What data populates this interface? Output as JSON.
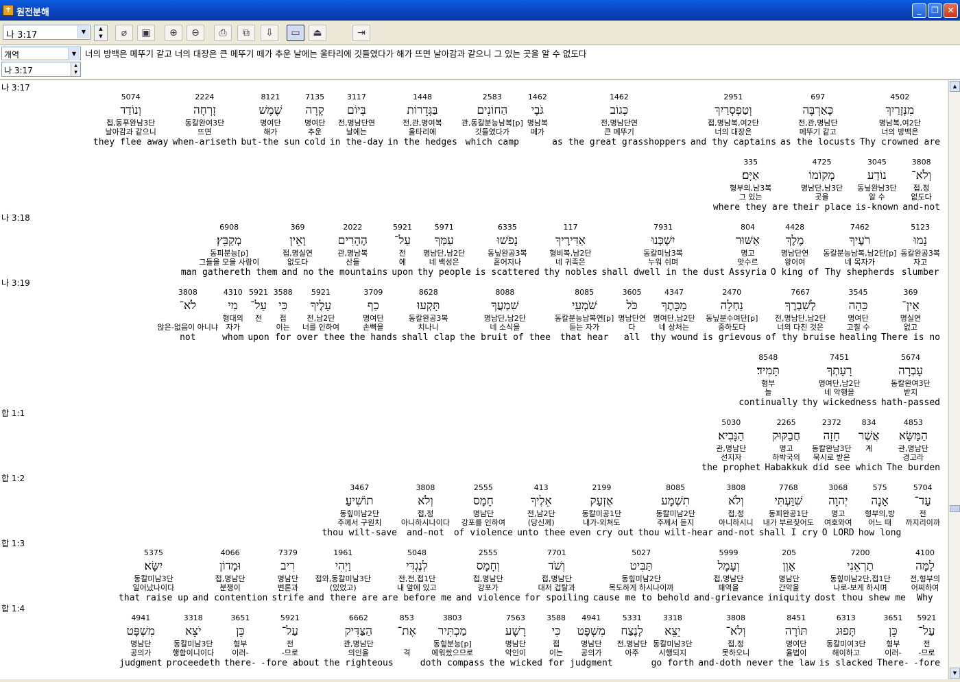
{
  "window": {
    "title": "원전분해"
  },
  "toolbar": {
    "ref_value": "나 3:17"
  },
  "info": {
    "version": "개역",
    "verse_text": "너의 방백은 메뚜기 같고 너의 대장은 큰 메뚜기 떼가 추운 날에는 울타리에 깃들였다가 해가 뜨면 날아감과 같으니 그 있는 곳을 알 수 없도다",
    "ref_value": "나 3:17"
  },
  "rows": [
    {
      "ref": "나 3:17",
      "words": [
        {
          "num": "4502",
          "heb": "מִנְּזָרַיִךְ",
          "parse": "명남복,여2단",
          "kor": "너의 방백은",
          "eng": "Thy crowned are"
        },
        {
          "num": "697",
          "heb": "כָּאַרְבֶּה",
          "parse": "전,관,명남단",
          "kor": "메뚜기 같고",
          "eng": "as the locusts"
        },
        {
          "num": "2951",
          "heb": "וְטַפְסְרַיִךְ",
          "parse": "접,명남복,여2단",
          "kor": "너의 대장은",
          "eng": "and thy captains"
        },
        {
          "num": "1462",
          "heb": "כְּגוֹב",
          "parse": "전,명남단연",
          "kor": "큰 메뚜기",
          "eng": "as the great grasshoppers"
        },
        {
          "num": "1462",
          "heb": "גֹּבָי",
          "parse": "명남복",
          "kor": "떼가",
          "eng": ""
        },
        {
          "num": "2583",
          "heb": "הַחוֹנִים",
          "parse": "관,동칼분능남복[p]",
          "kor": "깃들였다가",
          "eng": "which camp"
        },
        {
          "num": "1448",
          "heb": "בַּגְּדֵרוֹת",
          "parse": "전,관,명여복",
          "kor": "울타리에",
          "eng": "in the hedges"
        },
        {
          "num": "3117",
          "heb": "בְּיוֹם",
          "parse": "전,명남단연",
          "kor": "날에는",
          "eng": "in the-day"
        },
        {
          "num": "7135",
          "heb": "קָרָה",
          "parse": "명여단",
          "kor": "추운",
          "eng": "cold"
        },
        {
          "num": "8121",
          "heb": "שֶׁמֶשׁ",
          "parse": "명여단",
          "kor": "해가",
          "eng": "but-the sun"
        },
        {
          "num": "2224",
          "heb": "זָרְחָה",
          "parse": "동칼완여3단",
          "kor": "뜨면",
          "eng": "when-ariseth"
        },
        {
          "num": "5074",
          "heb": "וְנוֹדַד",
          "parse": "접,동푸완남3단",
          "kor": "날아감과 같으니",
          "eng": "they flee away"
        }
      ]
    },
    {
      "ref": "",
      "words": [
        {
          "num": "3808",
          "heb": "וְלֹא־",
          "parse": "접,정",
          "kor": "없도다",
          "eng": "and-not"
        },
        {
          "num": "3045",
          "heb": "נוֹדַע",
          "parse": "동닢완남3단",
          "kor": "알 수",
          "eng": "is-known"
        },
        {
          "num": "4725",
          "heb": "מְקוֹמוֹ",
          "parse": "명남단,남3단",
          "kor": "곳을",
          "eng": "their place"
        },
        {
          "num": "335",
          "heb": "אַיָּם׃",
          "parse": "형부의,남3복",
          "kor": "그 있는",
          "eng": "where they are"
        }
      ]
    },
    {
      "ref": "나 3:18",
      "words": [
        {
          "num": "5123",
          "heb": "נָמוּ",
          "parse": "동칼완공3복",
          "kor": "자고",
          "eng": "slumber"
        },
        {
          "num": "7462",
          "heb": "רֹעֶיךָ",
          "parse": "동칼분능남복,남2단[p]",
          "kor": "네 목자가",
          "eng": "Thy shepherds"
        },
        {
          "num": "4428",
          "heb": "מֶלֶךְ",
          "parse": "명남단연",
          "kor": "왕이여",
          "eng": "O king of"
        },
        {
          "num": "804",
          "heb": "אַשּׁוּר",
          "parse": "명고",
          "kor": "앗수르",
          "eng": "Assyria"
        },
        {
          "num": "7931",
          "heb": "יִשְׁכְּנוּ",
          "parse": "동칼미남3복",
          "kor": "누워 쉬며",
          "eng": "shall dwell in the dust"
        },
        {
          "num": "117",
          "heb": "אַדִּירֶיךָ",
          "parse": "형비복,남2단",
          "kor": "네 귀족은",
          "eng": "thy nobles"
        },
        {
          "num": "6335",
          "heb": "נָפֹשׁוּ",
          "parse": "동닢완공3복",
          "kor": "흩어지나",
          "eng": "is scattered"
        },
        {
          "num": "5971",
          "heb": "עַמְּךָ",
          "parse": "명남단,남2단",
          "kor": "네 백성은",
          "eng": "thy people"
        },
        {
          "num": "5921",
          "heb": "עַל־",
          "parse": "전",
          "kor": "에",
          "eng": "upon"
        },
        {
          "num": "2022",
          "heb": "הֶהָרִים",
          "parse": "관,명남복",
          "kor": "산들",
          "eng": "the mountains"
        },
        {
          "num": "369",
          "heb": "וְאֵין",
          "parse": "접,명실연",
          "kor": "없도다",
          "eng": "and no"
        },
        {
          "num": "6908",
          "heb": "מְקַבֵּץ׃",
          "parse": "동피분능[p]",
          "kor": "그들을 모을 사람이",
          "eng": "man gathereth them"
        }
      ]
    },
    {
      "ref": "나 3:19",
      "words": [
        {
          "num": "369",
          "heb": "אֵין־",
          "parse": "명실연",
          "kor": "없고",
          "eng": "There is no"
        },
        {
          "num": "3545",
          "heb": "כֵּהָה",
          "parse": "명여단",
          "kor": "고칠 수",
          "eng": "healing"
        },
        {
          "num": "7667",
          "heb": "לְשִׁבְרֶךָ",
          "parse": "전,명남단,남2단",
          "kor": "너의 다친 것은",
          "eng": "of thy bruise"
        },
        {
          "num": "2470",
          "heb": "נַחְלָה",
          "parse": "동닢분수여단[p]",
          "kor": "중하도다",
          "eng": "is grievous"
        },
        {
          "num": "4347",
          "heb": "מַכָּתֶךָ",
          "parse": "명여단,남2단",
          "kor": "네 상처는",
          "eng": "thy wound"
        },
        {
          "num": "3605",
          "heb": "כֹּל",
          "parse": "명남단연",
          "kor": "다",
          "eng": "all"
        },
        {
          "num": "8085",
          "heb": "שֹׁמְעֵי",
          "parse": "동칼분능남복연[p]",
          "kor": "듣는 자가",
          "eng": "that hear"
        },
        {
          "num": "8088",
          "heb": "שִׁמְעֲךָ",
          "parse": "명남단,남2단",
          "kor": "네 소식을",
          "eng": "the bruit of thee"
        },
        {
          "num": "8628",
          "heb": "תָּקְעוּ",
          "parse": "동칼완공3복",
          "kor": "치나니",
          "eng": "shall clap"
        },
        {
          "num": "3709",
          "heb": "כַף",
          "parse": "명여단",
          "kor": "손뼉을",
          "eng": "the hands"
        },
        {
          "num": "5921",
          "heb": "עָלֶיךָ",
          "parse": "전,남2단",
          "kor": "너를 인하여",
          "eng": "over thee"
        },
        {
          "num": "3588",
          "heb": "כִּי",
          "parse": "접",
          "kor": "이는",
          "eng": "for"
        },
        {
          "num": "5921",
          "heb": "עַל־",
          "parse": "전",
          "kor": "",
          "eng": "upon"
        },
        {
          "num": "4310",
          "heb": "מִי",
          "parse": "형대의",
          "kor": "자가",
          "eng": "whom"
        },
        {
          "num": "3808",
          "heb": "לֹא־",
          "parse": "",
          "kor": "않은-없음이 아니냐",
          "eng": "not"
        }
      ]
    },
    {
      "ref": "",
      "words": [
        {
          "num": "5674",
          "heb": "עָבְרָה",
          "parse": "동칼완여3단",
          "kor": "받지",
          "eng": "hath-passed"
        },
        {
          "num": "7451",
          "heb": "רָעָתְךָ",
          "parse": "명여단,남2단",
          "kor": "네 악행을",
          "eng": "thy wickedness"
        },
        {
          "num": "8548",
          "heb": "תָּמִיד׃",
          "parse": "형부",
          "kor": "늘",
          "eng": "continually"
        }
      ]
    },
    {
      "ref": "합 1:1",
      "words": [
        {
          "num": "4853",
          "heb": "הַמַּשָּׂא",
          "parse": "관,명남단",
          "kor": "경고라",
          "eng": "The burden"
        },
        {
          "num": "834",
          "heb": "אֲשֶׁר",
          "parse": "계",
          "kor": "",
          "eng": "which"
        },
        {
          "num": "2372",
          "heb": "חָזָה",
          "parse": "동칼완남3단",
          "kor": "묵시로 받은",
          "eng": "did see"
        },
        {
          "num": "2265",
          "heb": "חֲבַקּוּק",
          "parse": "명고",
          "kor": "하박국의",
          "eng": "Habakkuk"
        },
        {
          "num": "5030",
          "heb": "הַנָּבִיא׃",
          "parse": "관,명남단",
          "kor": "선지자",
          "eng": "the prophet"
        }
      ]
    },
    {
      "ref": "합 1:2",
      "words": [
        {
          "num": "5704",
          "heb": "עַד־",
          "parse": "전",
          "kor": "까지리이까",
          "eng": ""
        },
        {
          "num": "575",
          "heb": "אָנָה",
          "parse": "형부의,방",
          "kor": "어느 때",
          "eng": "how long"
        },
        {
          "num": "3068",
          "heb": "יְהוָה",
          "parse": "명고",
          "kor": "여호와여",
          "eng": "O LORD"
        },
        {
          "num": "7768",
          "heb": "שִׁוַּעְתִּי",
          "parse": "동피완공1단",
          "kor": "내가 부르짖어도",
          "eng": "shall I cry"
        },
        {
          "num": "3808",
          "heb": "וְלֹא",
          "parse": "접,정",
          "kor": "아니하시니",
          "eng": "and-not"
        },
        {
          "num": "8085",
          "heb": "תִשְׁמָע",
          "parse": "동칼미남2단",
          "kor": "주께서 듣지",
          "eng": "thou wilt-hear"
        },
        {
          "num": "2199",
          "heb": "אֶזְעַק",
          "parse": "동칼미공1단",
          "kor": "내가-외쳐도",
          "eng": "even cry out"
        },
        {
          "num": "413",
          "heb": "אֵלֶיךָ",
          "parse": "전,남2단",
          "kor": "(당신께)",
          "eng": "unto thee"
        },
        {
          "num": "2555",
          "heb": "חָמָס",
          "parse": "명남단",
          "kor": "강포를 인하여",
          "eng": "of violence"
        },
        {
          "num": "3808",
          "heb": "וְלֹא",
          "parse": "접,정",
          "kor": "아니하시나이다",
          "eng": "and-not"
        },
        {
          "num": "3467",
          "heb": "תוֹשִׁיעַ׃",
          "parse": "동힢미남2단",
          "kor": "주께서 구원치",
          "eng": "thou wilt-save"
        }
      ]
    },
    {
      "ref": "합 1:3",
      "words": [
        {
          "num": "4100",
          "heb": "לָמָּה",
          "parse": "전,형부의",
          "kor": "어찌하여",
          "eng": "Why"
        },
        {
          "num": "7200",
          "heb": "תַרְאֵנִי",
          "parse": "동힢미남2단,접1단",
          "kor": "나로-보게 하시며",
          "eng": "dost thou shew me"
        },
        {
          "num": "205",
          "heb": "אָוֶן",
          "parse": "명남단",
          "kor": "간악을",
          "eng": "iniquity"
        },
        {
          "num": "5999",
          "heb": "וְעָמָל",
          "parse": "접,명남단",
          "kor": "패역을",
          "eng": "and-grievance"
        },
        {
          "num": "5027",
          "heb": "תַּבִּיט",
          "parse": "동힢미남2단",
          "kor": "목도하게 하시나이까",
          "eng": "cause me to behold"
        },
        {
          "num": "7701",
          "heb": "וְשֹׁד",
          "parse": "접,명남단",
          "kor": "대저 겁탈과",
          "eng": "for spoiling"
        },
        {
          "num": "2555",
          "heb": "וְחָמָס",
          "parse": "접,명남단",
          "kor": "강포가",
          "eng": "and violence"
        },
        {
          "num": "5048",
          "heb": "לְנֶגְדִּי",
          "parse": "전,전,접1단",
          "kor": "내 앞에 있고",
          "eng": "are before me"
        },
        {
          "num": "1961",
          "heb": "וַיְהִי",
          "parse": "접와,동칼미남3단",
          "kor": "(있었고)",
          "eng": "and there are"
        },
        {
          "num": "7379",
          "heb": "רִיב",
          "parse": "명남단",
          "kor": "변론과",
          "eng": "strife"
        },
        {
          "num": "4066",
          "heb": "וּמָדוֹן",
          "parse": "접,명남단",
          "kor": "분쟁이",
          "eng": "and contention"
        },
        {
          "num": "5375",
          "heb": "יִשָּׂא׃",
          "parse": "동칼미남3단",
          "kor": "일어났나이다",
          "eng": "that raise up"
        }
      ]
    },
    {
      "ref": "합 1:4",
      "words": [
        {
          "num": "5921",
          "heb": "עַל־",
          "parse": "전",
          "kor": "-므로",
          "eng": "-fore"
        },
        {
          "num": "3651",
          "heb": "כֵּן",
          "parse": "형부",
          "kor": "이러-",
          "eng": "There-"
        },
        {
          "num": "6313",
          "heb": "תָּפוּג",
          "parse": "동칼미여3단",
          "kor": "해이하고",
          "eng": "is slacked"
        },
        {
          "num": "8451",
          "heb": "תּוֹרָה",
          "parse": "명여단",
          "kor": "율법이",
          "eng": "the law"
        },
        {
          "num": "3808",
          "heb": "וְלֹא־",
          "parse": "접,정",
          "kor": "못하오니",
          "eng": "and-doth never"
        },
        {
          "num": "3318",
          "heb": "יֵצֵא",
          "parse": "동칼미남3단",
          "kor": "시행되지",
          "eng": "go forth"
        },
        {
          "num": "5331",
          "heb": "לָנֶצַח",
          "parse": "전,명남단",
          "kor": "아주",
          "eng": ""
        },
        {
          "num": "4941",
          "heb": "מִשְׁפָּט",
          "parse": "명남단",
          "kor": "공의가",
          "eng": "judgment"
        },
        {
          "num": "3588",
          "heb": "כִּי",
          "parse": "접",
          "kor": "이는",
          "eng": "for"
        },
        {
          "num": "7563",
          "heb": "רָשָׁע",
          "parse": "명남단",
          "kor": "악인이",
          "eng": "the wicked"
        },
        {
          "num": "3803",
          "heb": "מַכְתִּיר",
          "parse": "동힢분능[p]",
          "kor": "에워쌌으므로",
          "eng": "doth compass"
        },
        {
          "num": "853",
          "heb": "אֶת־",
          "parse": "",
          "kor": "격",
          "eng": ""
        },
        {
          "num": "6662",
          "heb": "הַצַּדִּיק",
          "parse": "관,명남단",
          "kor": "의인을",
          "eng": "the righteous"
        },
        {
          "num": "5921",
          "heb": "עַל־",
          "parse": "전",
          "kor": "-므로",
          "eng": "-fore about"
        },
        {
          "num": "3651",
          "heb": "כֵּן",
          "parse": "형부",
          "kor": "이러-",
          "eng": "there-"
        },
        {
          "num": "3318",
          "heb": "יֹצֵא",
          "parse": "동칼미남3단",
          "kor": "행함이니이다",
          "eng": "proceedeth"
        },
        {
          "num": "4941",
          "heb": "מִשְׁפָּט",
          "parse": "명남단",
          "kor": "공의가",
          "eng": "judgment"
        }
      ]
    }
  ]
}
